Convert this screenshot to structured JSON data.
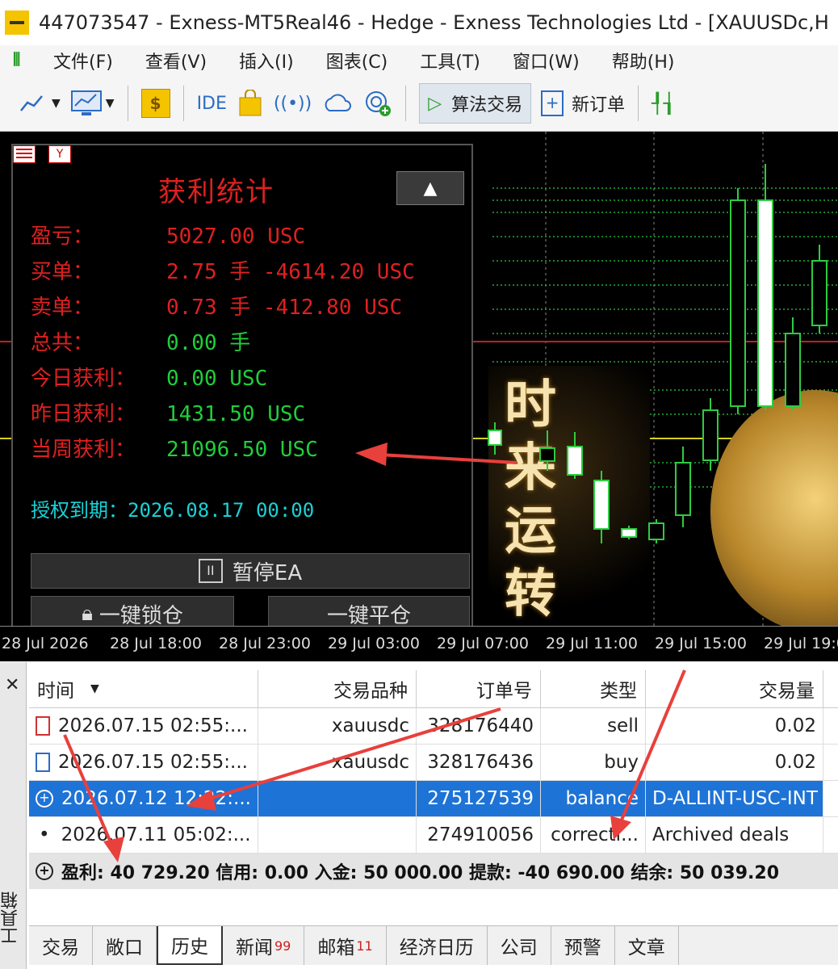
{
  "window": {
    "title": "447073547 - Exness-MT5Real46 - Hedge - Exness Technologies Ltd - [XAUUSDc,H"
  },
  "menu": [
    "文件(F)",
    "查看(V)",
    "插入(I)",
    "图表(C)",
    "工具(T)",
    "窗口(W)",
    "帮助(H)"
  ],
  "toolbar": {
    "ide_label": "IDE",
    "algo_label": "算法交易",
    "new_order_label": "新订单"
  },
  "panel": {
    "icons": [
      "list-icon",
      "tune-icon"
    ],
    "title": "获利统计",
    "collapse_label": "▲",
    "rows": [
      {
        "label": "盈亏：",
        "value": "5027.00 USC"
      },
      {
        "label": "买单：",
        "value": "2.75 手 -4614.20 USC"
      },
      {
        "label": "卖单：",
        "value": "0.73 手 -412.80 USC"
      },
      {
        "label": "总共：",
        "value": "0.00 手"
      },
      {
        "label": "今日获利：",
        "value": "0.00 USC"
      },
      {
        "label": "昨日获利：",
        "value": "1431.50 USC"
      },
      {
        "label": "当周获利：",
        "value": "21096.50 USC"
      }
    ],
    "license_label": "授权到期：",
    "license_value": "2026.08.17 00:00",
    "pause_label": "暂停EA",
    "lock_label": "一键锁仓",
    "close_all_label": "一键平仓"
  },
  "banner_text": [
    "时",
    "来",
    "运",
    "转"
  ],
  "axis": [
    "28 Jul 2026",
    "28 Jul 18:00",
    "28 Jul 23:00",
    "29 Jul 03:00",
    "29 Jul 07:00",
    "29 Jul 11:00",
    "29 Jul 15:00",
    "29 Jul 19:0"
  ],
  "table": {
    "columns": [
      "时间",
      "交易品种",
      "订单号",
      "类型",
      "交易量"
    ],
    "rows": [
      {
        "time": "2026.07.15 02:55:...",
        "symbol": "xauusdc",
        "order": "328176440",
        "type": "sell",
        "volume": "0.02"
      },
      {
        "time": "2026.07.15 02:55:...",
        "symbol": "xauusdc",
        "order": "328176436",
        "type": "buy",
        "volume": "0.02"
      },
      {
        "time": "2026.07.12 12:22:...",
        "symbol": "",
        "order": "275127539",
        "type": "balance",
        "volume": "D-ALLINT-USC-INT"
      },
      {
        "time": "2026.07.11 05:02:...",
        "symbol": "",
        "order": "274910056",
        "type": "correcti...",
        "volume": "Archived deals"
      }
    ],
    "summary": "盈利: 40 729.20  信用: 0.00  入金: 50 000.00  提款: -40 690.00  结余: 50 039.20"
  },
  "side_label": "工具箱",
  "tabs": [
    {
      "label": "交易",
      "badge": ""
    },
    {
      "label": "敞口",
      "badge": ""
    },
    {
      "label": "历史",
      "badge": ""
    },
    {
      "label": "新闻",
      "badge": "99"
    },
    {
      "label": "邮箱",
      "badge": "11"
    },
    {
      "label": "经济日历",
      "badge": ""
    },
    {
      "label": "公司",
      "badge": ""
    },
    {
      "label": "预警",
      "badge": ""
    },
    {
      "label": "文章",
      "badge": ""
    }
  ],
  "colors": {
    "profit_red": "#e02020",
    "profit_green": "#1fcf3a",
    "license_cyan": "#1ad1d6",
    "selected_row": "#1e73d6"
  }
}
